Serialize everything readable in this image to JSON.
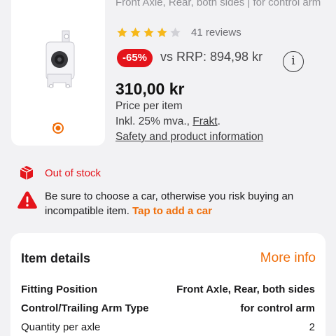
{
  "product": {
    "subtitle": "Front Axle, Rear, both sides | for control arm",
    "rating": 4,
    "max_rating": 5,
    "reviews": "41 reviews",
    "discount": "-65%",
    "rrp": "vs RRP: 894,98 kr",
    "info_icon": "i",
    "price": "310,00 kr",
    "price_label": "Price per item",
    "vat_text": "Inkl. 25% mva., ",
    "shipping_link": "Frakt",
    "vat_suffix": ".",
    "safety_link": "Safety and product information"
  },
  "stock": {
    "status": "Out of stock",
    "icon": "box-icon"
  },
  "warning": {
    "text": "Be sure to choose a car, otherwise you risk buying an incompatible item. ",
    "cta": "Tap to add a car",
    "icon": "warning-icon"
  },
  "details": {
    "title": "Item details",
    "more_info": "More info",
    "rows": [
      {
        "label": "Fitting Position",
        "value": "Front Axle, Rear, both sides"
      },
      {
        "label": "Control/Trailing Arm Type",
        "value": "for control arm"
      },
      {
        "label": "Quantity per axle",
        "value": "2"
      }
    ]
  },
  "colors": {
    "accent": "#f06e0a",
    "sale_red": "#e4141b",
    "star": "#f6b81b"
  }
}
